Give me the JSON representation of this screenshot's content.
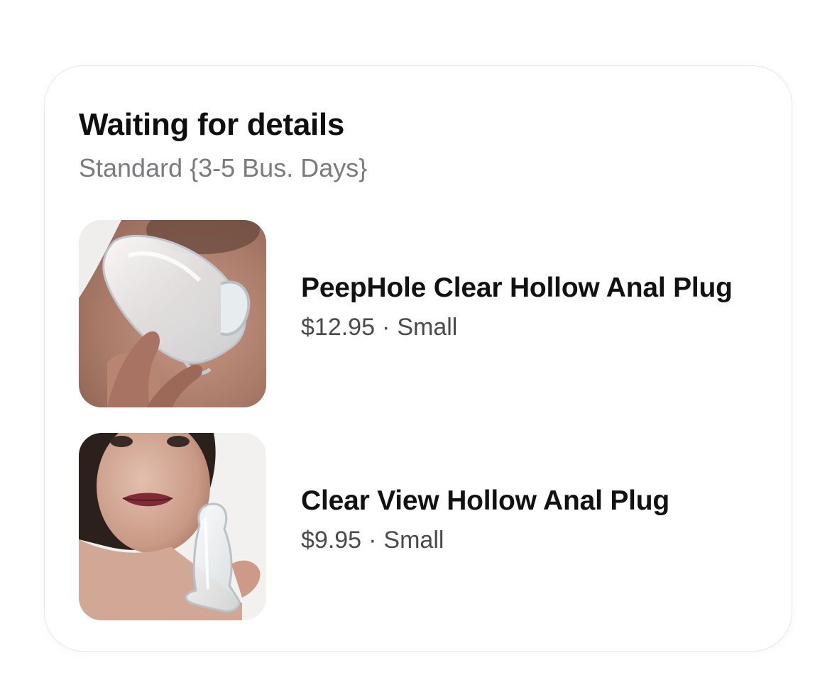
{
  "order_card": {
    "status_title": "Waiting for details",
    "shipping_method": "Standard {3-5 Bus. Days}",
    "items": [
      {
        "name": "PeepHole Clear Hollow Anal Plug",
        "price": "$12.95",
        "separator": "·",
        "variant": "Small",
        "thumbnail": "product-photo"
      },
      {
        "name": "Clear View Hollow Anal Plug",
        "price": "$9.95",
        "separator": "·",
        "variant": "Small",
        "thumbnail": "product-photo"
      }
    ]
  }
}
